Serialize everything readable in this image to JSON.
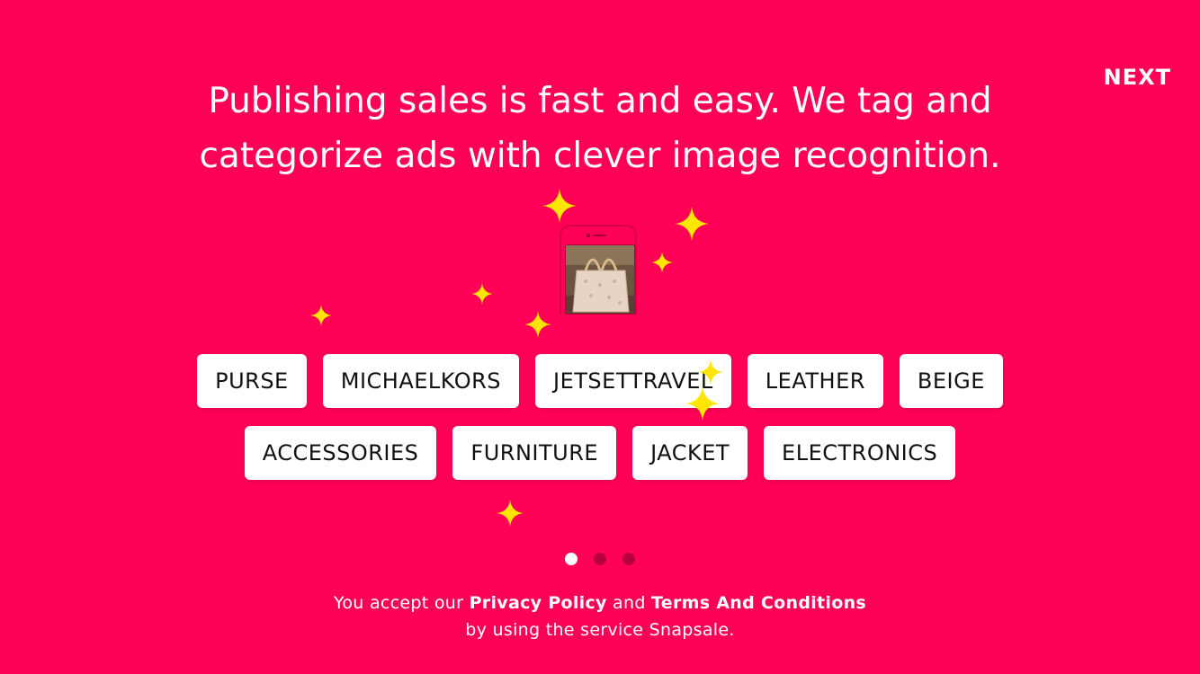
{
  "header": {
    "next_label": "NEXT"
  },
  "headline": {
    "line1": "Publishing sales is fast and easy. We tag and",
    "line2": "categorize ads with clever image recognition."
  },
  "tags": {
    "row1": [
      "PURSE",
      "MICHAELKORS",
      "JETSETTRAVEL",
      "LEATHER",
      "BEIGE"
    ],
    "row2": [
      "ACCESSORIES",
      "FURNITURE",
      "JACKET",
      "ELECTRONICS"
    ]
  },
  "pager": {
    "pages": 3,
    "current": 1
  },
  "footer": {
    "prefix": "You accept our",
    "privacy_label": "Privacy Policy",
    "and": "and",
    "terms_label": "Terms And Conditions",
    "line2": "by using the service Snapsale."
  },
  "colors": {
    "background": "#ff0057",
    "sparkle": "#ffe600",
    "tag_bg": "#ffffff",
    "tag_text": "#111111"
  },
  "icons": [
    "sparkle-icon",
    "phone-icon",
    "purse-photo"
  ]
}
